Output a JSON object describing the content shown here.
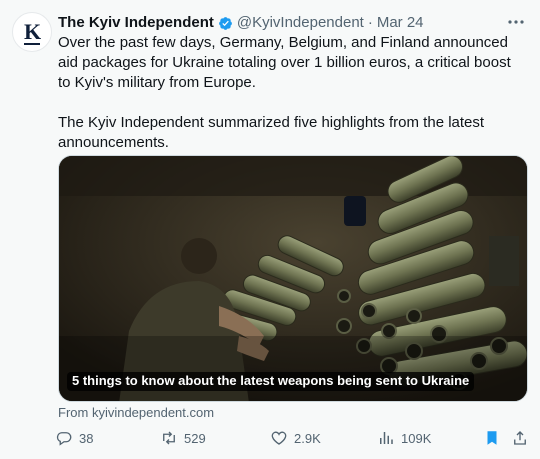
{
  "tweet": {
    "author_name": "The Kyiv Independent",
    "handle": "@KyivIndependent",
    "separator": "·",
    "date": "Mar 24",
    "avatar_letter": "K",
    "paragraph_1": "Over the past few days, Germany, Belgium, and Finland announced aid packages for Ukraine totaling over 1 billion euros, a critical boost to Kyiv's military from Europe.",
    "paragraph_2": "The Kyiv Independent summarized five highlights from the latest announcements.",
    "media_caption": "5 things to know about the latest weapons being sent to Ukraine",
    "source": "From kyivindependent.com"
  },
  "actions": {
    "replies": "38",
    "reposts": "529",
    "likes": "2.9K",
    "views": "109K"
  },
  "colors": {
    "verified": "#1d9bf0",
    "bookmark": "#1d9bf0",
    "muted": "#536471"
  },
  "icons": [
    "verified-badge-icon",
    "more-options-icon",
    "reply-icon",
    "repost-icon",
    "like-icon",
    "views-icon",
    "bookmark-icon",
    "share-icon"
  ]
}
